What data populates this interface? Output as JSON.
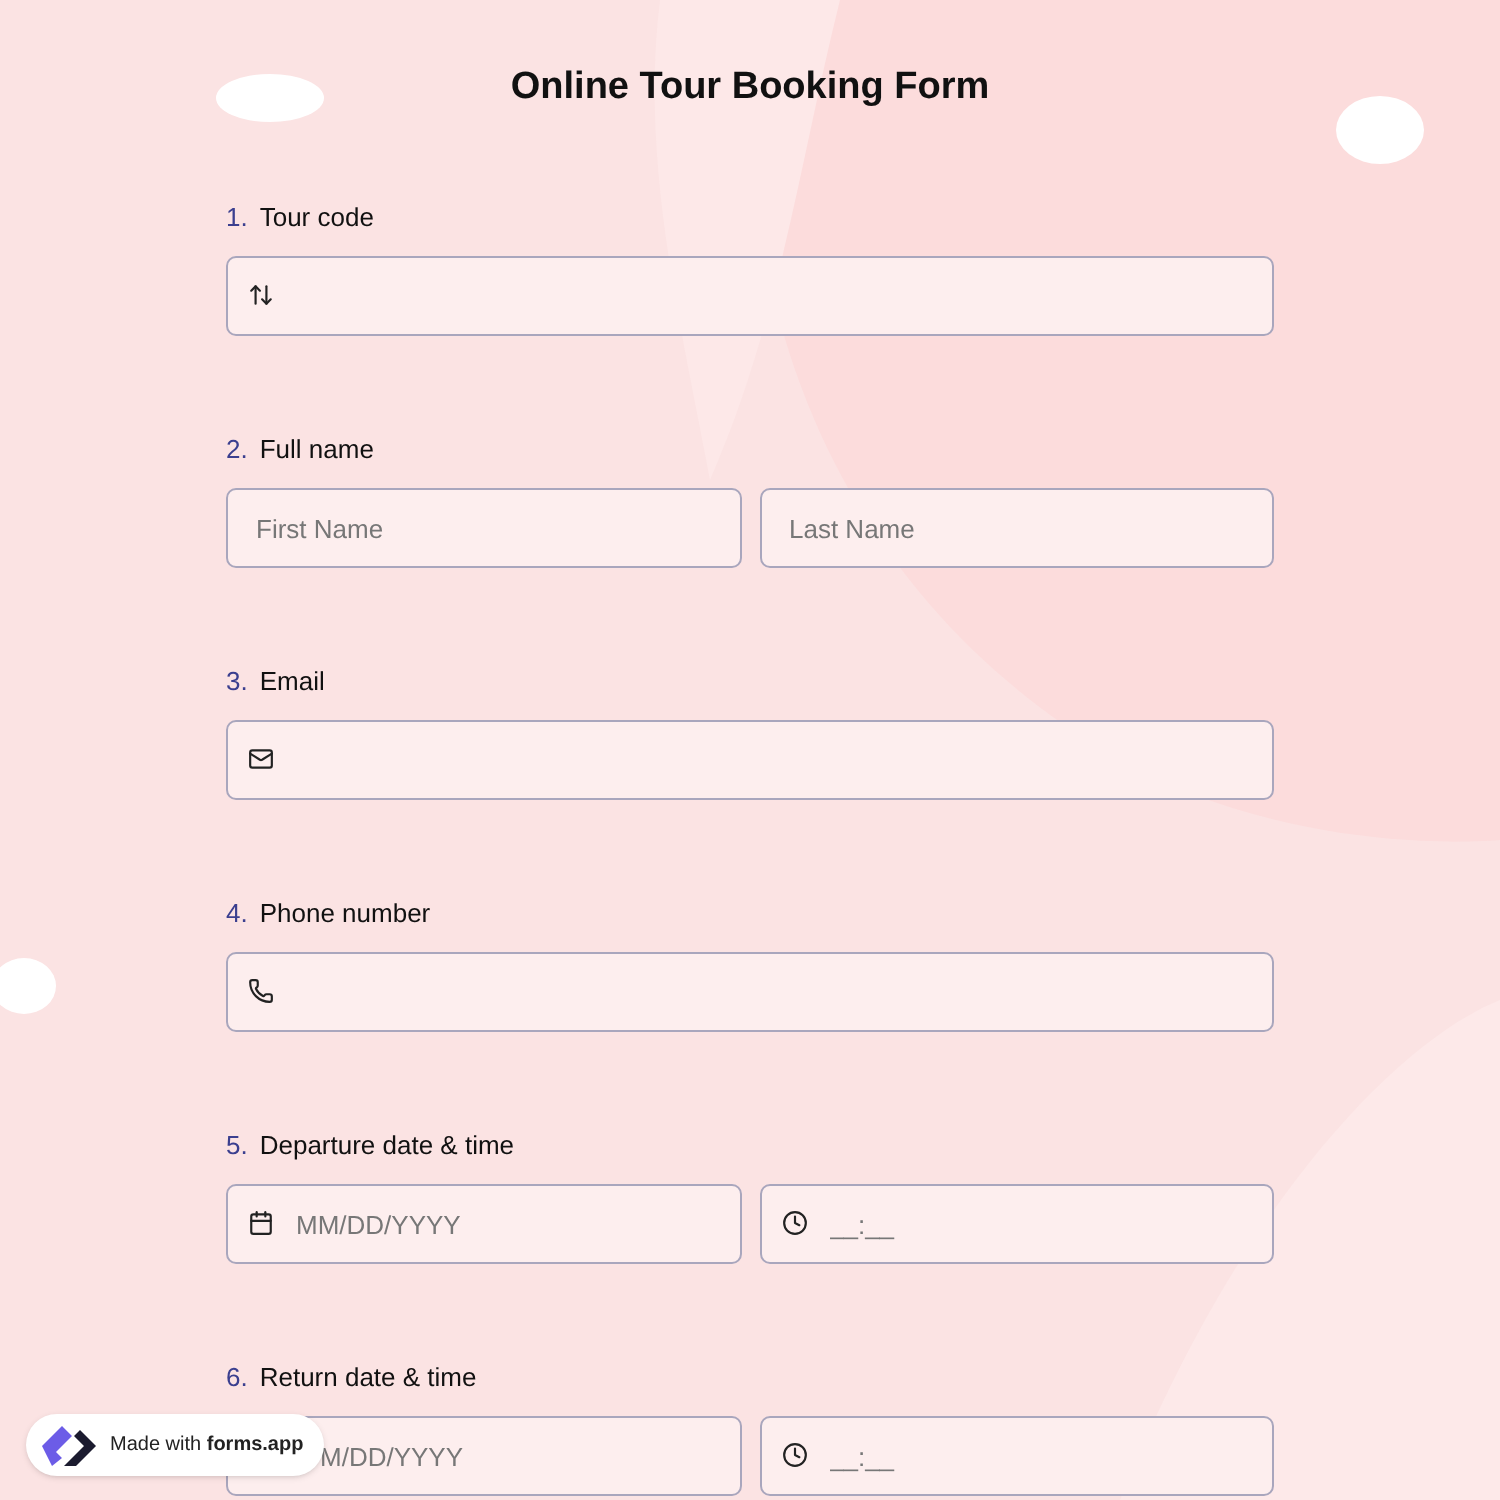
{
  "title": "Online Tour Booking Form",
  "questions": [
    {
      "number": "1.",
      "label": "Tour code",
      "fields": [
        {
          "kind": "code"
        }
      ]
    },
    {
      "number": "2.",
      "label": "Full name",
      "fields": [
        {
          "kind": "text",
          "placeholder": "First Name"
        },
        {
          "kind": "text",
          "placeholder": "Last Name"
        }
      ]
    },
    {
      "number": "3.",
      "label": "Email",
      "fields": [
        {
          "kind": "email"
        }
      ]
    },
    {
      "number": "4.",
      "label": "Phone number",
      "fields": [
        {
          "kind": "phone"
        }
      ]
    },
    {
      "number": "5.",
      "label": "Departure date & time",
      "fields": [
        {
          "kind": "date",
          "placeholder": "MM/DD/YYYY"
        },
        {
          "kind": "time",
          "placeholder": "__:__"
        }
      ]
    },
    {
      "number": "6.",
      "label": "Return date & time",
      "fields": [
        {
          "kind": "covered",
          "placeholder": "M/DD/YYYY"
        },
        {
          "kind": "time",
          "placeholder": "__:__"
        }
      ]
    }
  ],
  "badge": {
    "text": "Made with **forms.app**"
  }
}
